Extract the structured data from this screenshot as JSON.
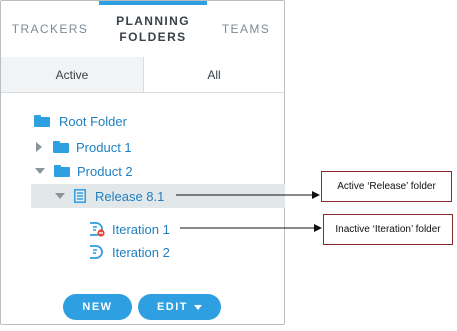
{
  "tabs": [
    {
      "label": "TRACKERS"
    },
    {
      "label": "PLANNING FOLDERS"
    },
    {
      "label": "TEAMS"
    }
  ],
  "filter": {
    "active_label": "Active",
    "all_label": "All"
  },
  "tree": {
    "root": "Root Folder",
    "product1": "Product 1",
    "product2": "Product 2",
    "release": "Release 8.1",
    "iteration1": "Iteration 1",
    "iteration2": "Iteration 2"
  },
  "buttons": {
    "new_label": "NEW",
    "edit_label": "EDIT"
  },
  "annotations": {
    "release_note": "Active ‘Release’ folder",
    "iteration_note": "Inactive ‘Iteration’ folder"
  },
  "colors": {
    "accent": "#2e9fe0",
    "link": "#1f7fc1",
    "selected_row": "#e2e7ea",
    "inactive_badge": "#e0463a",
    "callout_border": "#8b2a2a"
  }
}
